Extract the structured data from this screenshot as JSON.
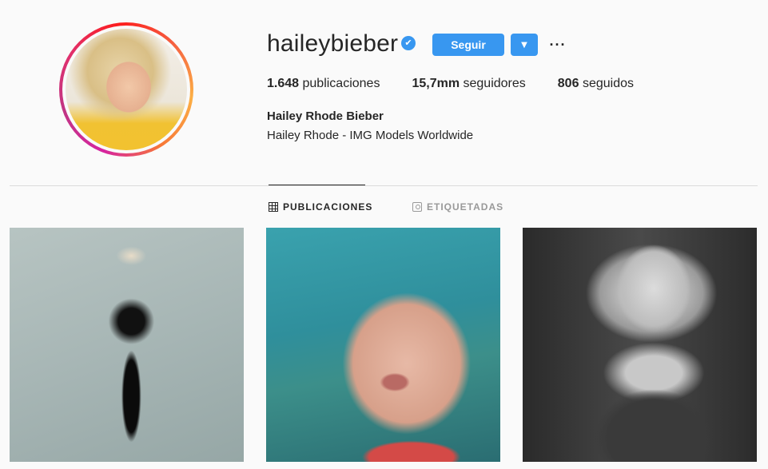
{
  "profile": {
    "username": "haileybieber",
    "verified_mark": "✔",
    "follow_label": "Seguir",
    "dropdown_glyph": "▼",
    "more_glyph": "···",
    "stats": {
      "posts_count": "1.648",
      "posts_label": "publicaciones",
      "followers_count": "15,7mm",
      "followers_label": "seguidores",
      "following_count": "806",
      "following_label": "seguidos"
    },
    "full_name": "Hailey Rhode Bieber",
    "bio": "Hailey Rhode - IMG Models Worldwide"
  },
  "tabs": [
    {
      "label": "PUBLICACIONES",
      "icon": "grid-icon",
      "active": true
    },
    {
      "label": "ETIQUETADAS",
      "icon": "tag-person-icon",
      "active": false
    }
  ],
  "colors": {
    "accent": "#3897f0",
    "text": "#262626",
    "muted": "#999999",
    "background": "#fafafa"
  }
}
